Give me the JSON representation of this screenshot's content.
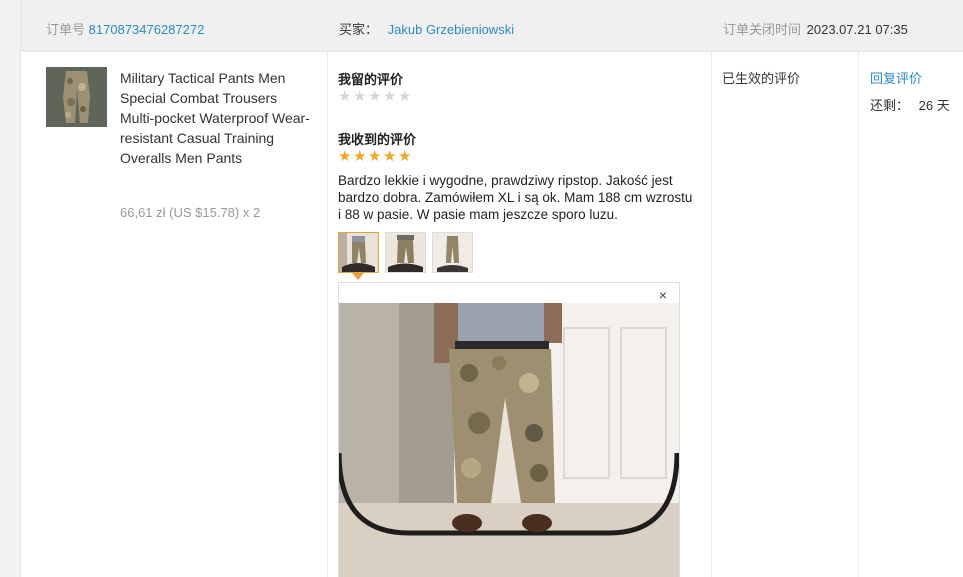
{
  "header": {
    "order_label": "订单号",
    "order_number": "8170873476287272",
    "buyer_label": "买家：",
    "buyer_name": "Jakub Grzebieniowski",
    "closed_label": "订单关闭时间",
    "closed_time": "2023.07.21 07:35"
  },
  "product": {
    "title": "Military Tactical Pants Men Special Combat Trousers Multi-pocket Waterproof Wear-resistant Casual Training Overalls Men Pants",
    "price": "66,61 zł (US $15.78) x 2",
    "thumb_icon": "camo-pants-image"
  },
  "my_review": {
    "title": "我留的评价",
    "rating": 0,
    "max": 5
  },
  "received_review": {
    "title": "我收到的评价",
    "rating": 5,
    "max": 5,
    "text": "Bardzo lekkie i wygodne, prawdziwy ripstop. Jakość jest bardzo dobra. Zamówiłem XL i są ok. Mam 188 cm wzrostu i 88 w pasie. W pasie mam jeszcze sporo luzu.",
    "photos": [
      "photo-1",
      "photo-2",
      "photo-3"
    ],
    "active_photo": 0,
    "close_symbol": "×"
  },
  "status": {
    "label": "已生效的评价"
  },
  "actions": {
    "reply_label": "回复评价",
    "remaining_label": "还剩：",
    "remaining_value": "26 天"
  },
  "colors": {
    "link": "#2a8cc7",
    "star_on": "#f5a623",
    "star_off": "#d6d6d6",
    "active_border": "#e6a23c"
  }
}
